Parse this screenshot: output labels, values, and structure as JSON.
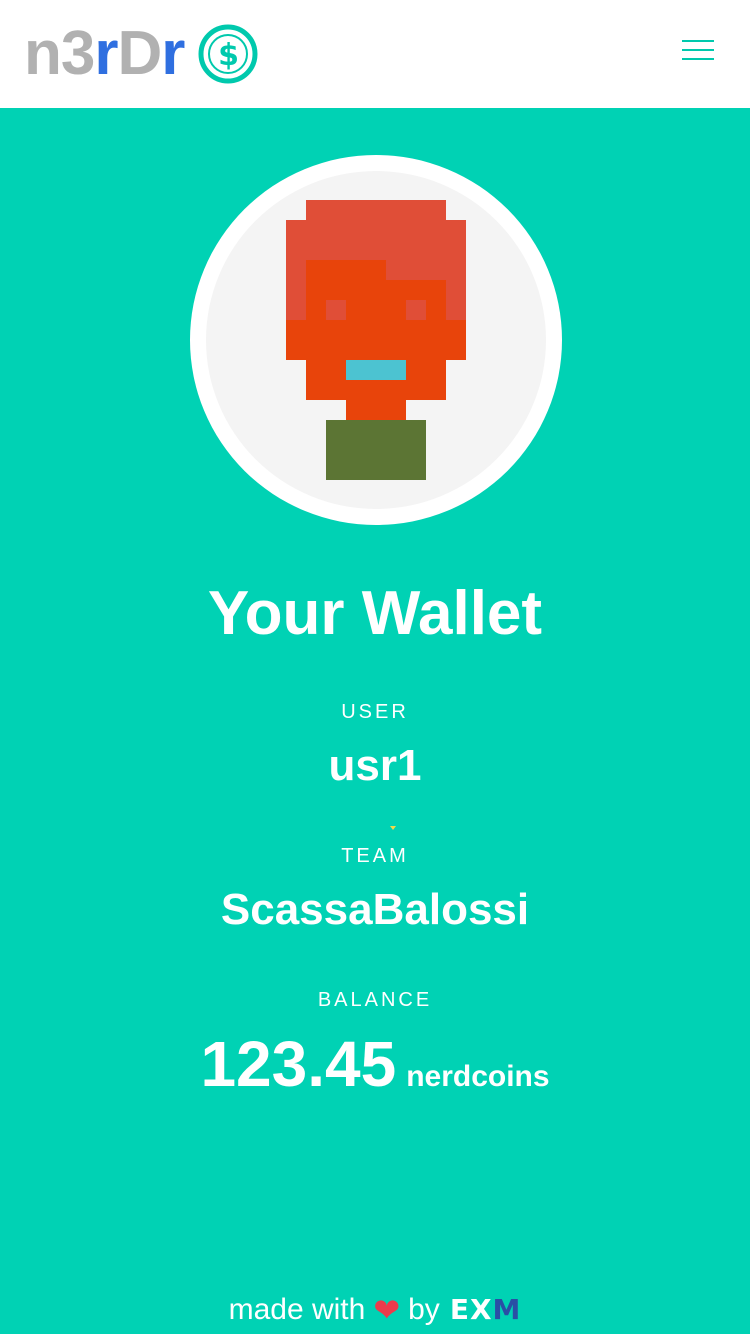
{
  "header": {
    "logo_part1": "n3",
    "logo_part2": "r",
    "logo_part3": "D",
    "logo_part4": "r",
    "coin_symbol": "$",
    "menu_icon": "hamburger-menu-icon"
  },
  "colors": {
    "background": "#00d2b4",
    "logo_gray": "#b1b1b1",
    "logo_blue": "#2f6fe0",
    "accent": "#00c9ad",
    "heart": "#ec3b4b"
  },
  "main": {
    "title": "Your Wallet",
    "user_label": "USER",
    "user_value": "usr1",
    "team_label": "TEAM",
    "team_value": "ScassaBalossi",
    "balance_label": "BALANCE",
    "balance_amount": "123.45",
    "balance_unit": "nerdcoins"
  },
  "footer": {
    "made_with": "made with",
    "by": "by",
    "brand_part1": "EX",
    "brand_part2": "M"
  }
}
